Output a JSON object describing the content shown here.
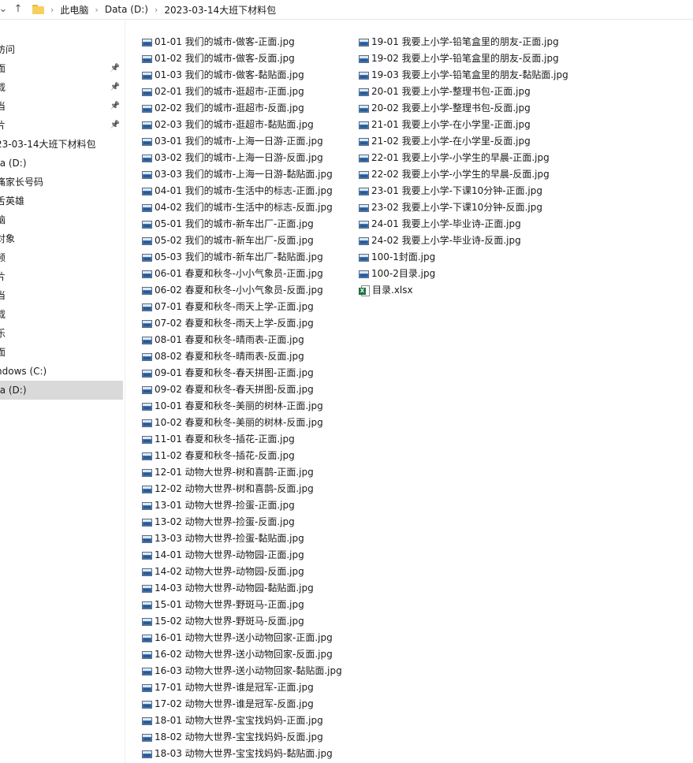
{
  "address_bar": {
    "back_icon": "chevron-down-icon",
    "up_icon": "up-arrow-icon",
    "crumbs": [
      "此电脑",
      "Data (D:)",
      "2023-03-14大班下材料包"
    ]
  },
  "nav_pane": {
    "items": [
      {
        "label": "访问",
        "pinned": false,
        "selected": false
      },
      {
        "label": "面",
        "pinned": true,
        "selected": false
      },
      {
        "label": "载",
        "pinned": true,
        "selected": false
      },
      {
        "label": "当",
        "pinned": true,
        "selected": false
      },
      {
        "label": "片",
        "pinned": true,
        "selected": false
      },
      {
        "label": "23-03-14大班下材料包",
        "pinned": false,
        "selected": false
      },
      {
        "label": "ta (D:)",
        "pinned": false,
        "selected": false
      },
      {
        "label": "痛家长号码",
        "pinned": false,
        "selected": false
      },
      {
        "label": "舌英雄",
        "pinned": false,
        "selected": false
      },
      {
        "label": "脑",
        "pinned": false,
        "selected": false
      },
      {
        "label": "对象",
        "pinned": false,
        "selected": false
      },
      {
        "label": "频",
        "pinned": false,
        "selected": false
      },
      {
        "label": "片",
        "pinned": false,
        "selected": false
      },
      {
        "label": "当",
        "pinned": false,
        "selected": false
      },
      {
        "label": "载",
        "pinned": false,
        "selected": false
      },
      {
        "label": "乐",
        "pinned": false,
        "selected": false
      },
      {
        "label": "面",
        "pinned": false,
        "selected": false
      },
      {
        "label": "ndows (C:)",
        "pinned": false,
        "selected": false
      },
      {
        "label": "ta (D:)",
        "pinned": false,
        "selected": true
      }
    ]
  },
  "file_list": {
    "column_1": [
      "01-01 我们的城市-做客-正面.jpg",
      "01-02 我们的城市-做客-反面.jpg",
      "01-03 我们的城市-做客-黏贴面.jpg",
      "02-01 我们的城市-逛超市-正面.jpg",
      "02-02 我们的城市-逛超市-反面.jpg",
      "02-03 我们的城市-逛超市-黏贴面.jpg",
      "03-01 我们的城市-上海一日游-正面.jpg",
      "03-02 我们的城市-上海一日游-反面.jpg",
      "03-03 我们的城市-上海一日游-黏贴面.jpg",
      "04-01 我们的城市-生活中的标志-正面.jpg",
      "04-02 我们的城市-生活中的标志-反面.jpg",
      "05-01 我们的城市-新车出厂-正面.jpg",
      "05-02 我们的城市-新车出厂-反面.jpg",
      "05-03 我们的城市-新车出厂-黏贴面.jpg",
      "06-01 春夏和秋冬-小小气象员-正面.jpg",
      "06-02 春夏和秋冬-小小气象员-反面.jpg",
      "07-01 春夏和秋冬-雨天上学-正面.jpg",
      "07-02 春夏和秋冬-雨天上学-反面.jpg",
      "08-01 春夏和秋冬-晴雨表-正面.jpg",
      "08-02 春夏和秋冬-晴雨表-反面.jpg",
      "09-01 春夏和秋冬-春天拼图-正面.jpg",
      "09-02 春夏和秋冬-春天拼图-反面.jpg",
      "10-01 春夏和秋冬-美丽的树林-正面.jpg",
      "10-02 春夏和秋冬-美丽的树林-反面.jpg",
      "11-01 春夏和秋冬-插花-正面.jpg",
      "11-02 春夏和秋冬-插花-反面.jpg",
      "12-01 动物大世界-树和喜鹊-正面.jpg",
      "12-02 动物大世界-树和喜鹊-反面.jpg",
      "13-01 动物大世界-捡蛋-正面.jpg",
      "13-02 动物大世界-捡蛋-反面.jpg",
      "13-03 动物大世界-捡蛋-黏贴面.jpg",
      "14-01 动物大世界-动物园-正面.jpg",
      "14-02 动物大世界-动物园-反面.jpg",
      "14-03 动物大世界-动物园-黏贴面.jpg",
      "15-01 动物大世界-野斑马-正面.jpg",
      "15-02 动物大世界-野斑马-反面.jpg",
      "16-01 动物大世界-送小动物回家-正面.jpg",
      "16-02 动物大世界-送小动物回家-反面.jpg",
      "16-03 动物大世界-送小动物回家-黏贴面.jpg",
      "17-01 动物大世界-谁是冠军-正面.jpg",
      "17-02 动物大世界-谁是冠军-反面.jpg",
      "18-01 动物大世界-宝宝找妈妈-正面.jpg",
      "18-02 动物大世界-宝宝找妈妈-反面.jpg",
      "18-03 动物大世界-宝宝找妈妈-黏贴面.jpg"
    ],
    "column_2": [
      "19-01 我要上小学-铅笔盒里的朋友-正面.jpg",
      "19-02 我要上小学-铅笔盒里的朋友-反面.jpg",
      "19-03 我要上小学-铅笔盒里的朋友-黏贴面.jpg",
      "20-01 我要上小学-整理书包-正面.jpg",
      "20-02 我要上小学-整理书包-反面.jpg",
      "21-01 我要上小学-在小学里-正面.jpg",
      "21-02 我要上小学-在小学里-反面.jpg",
      "22-01 我要上小学-小学生的早晨-正面.jpg",
      "22-02 我要上小学-小学生的早晨-反面.jpg",
      "23-01 我要上小学-下课10分钟-正面.jpg",
      "23-02 我要上小学-下课10分钟-反面.jpg",
      "24-01 我要上小学-毕业诗-正面.jpg",
      "24-02 我要上小学-毕业诗-反面.jpg",
      "100-1封面.jpg",
      "100-2目录.jpg"
    ],
    "xlsx_file": "目录.xlsx",
    "icons": {
      "image_file": "image-file-icon",
      "excel_file": "excel-file-icon"
    }
  }
}
